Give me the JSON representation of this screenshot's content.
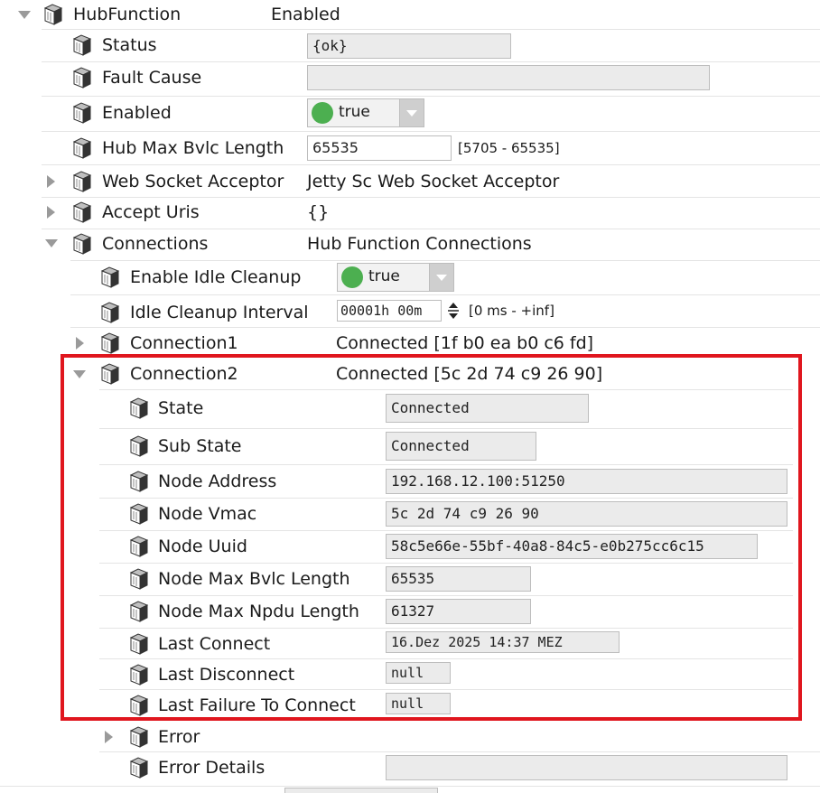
{
  "hub": {
    "label": "HubFunction",
    "value": "Enabled",
    "status": {
      "label": "Status",
      "value": "{ok}"
    },
    "fault_cause": {
      "label": "Fault Cause",
      "value": ""
    },
    "enabled": {
      "label": "Enabled",
      "value": "true"
    },
    "max_bvlc": {
      "label": "Hub Max Bvlc Length",
      "value": "65535",
      "range": "[5705 - 65535]"
    },
    "web_socket": {
      "label": "Web Socket Acceptor",
      "value": "Jetty Sc Web Socket Acceptor"
    },
    "accept_uris": {
      "label": "Accept Uris",
      "value": "{}"
    }
  },
  "connections": {
    "label": "Connections",
    "value": "Hub Function Connections",
    "idle_cleanup": {
      "label": "Enable Idle Cleanup",
      "value": "true"
    },
    "idle_interval": {
      "label": "Idle Cleanup Interval",
      "value": "00001h 00m",
      "range": "[0 ms - +inf]"
    },
    "connection1": {
      "label": "Connection1",
      "value": "Connected [1f b0 ea b0 c6 fd]"
    },
    "connection2": {
      "label": "Connection2",
      "value": "Connected [5c 2d 74 c9 26 90]",
      "fields": [
        {
          "label": "State",
          "value": "Connected"
        },
        {
          "label": "Sub State",
          "value": "Connected"
        },
        {
          "label": "Node Address",
          "value": "192.168.12.100:51250"
        },
        {
          "label": "Node Vmac",
          "value": "5c 2d 74 c9 26 90"
        },
        {
          "label": "Node Uuid",
          "value": "58c5e66e-55bf-40a8-84c5-e0b275cc6c15"
        },
        {
          "label": "Node Max Bvlc Length",
          "value": "65535"
        },
        {
          "label": "Node Max Npdu Length",
          "value": "61327"
        },
        {
          "label": "Last Connect",
          "value": "16.Dez 2025 14:37 MEZ"
        },
        {
          "label": "Last Disconnect",
          "value": "null"
        },
        {
          "label": "Last Failure To Connect",
          "value": "null"
        }
      ]
    }
  },
  "error": {
    "label": "Error"
  },
  "error_details": {
    "label": "Error Details",
    "value": ""
  },
  "colors": {
    "highlight": "#e0161e",
    "status_green": "#4caf50"
  }
}
